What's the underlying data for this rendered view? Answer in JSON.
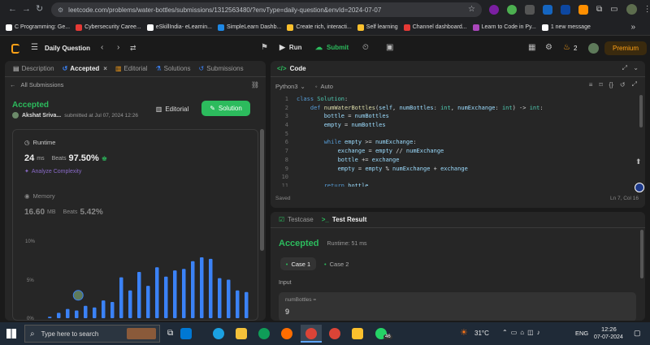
{
  "browser": {
    "url": "leetcode.com/problems/water-bottles/submissions/1312563480/?envType=daily-question&envId=2024-07-07",
    "bookmarks": [
      {
        "label": "C Programming: Ge...",
        "color": "#ffffff"
      },
      {
        "label": "Cybersecurity Caree...",
        "color": "#e53935"
      },
      {
        "label": "eSkillIndia- eLearnin...",
        "color": "#ffffff"
      },
      {
        "label": "SimpleLearn Dashb...",
        "color": "#1e88e5"
      },
      {
        "label": "Create rich, interacti...",
        "color": "#fbc02d"
      },
      {
        "label": "Self learning",
        "color": "#fbc02d"
      },
      {
        "label": "Channel dashboard...",
        "color": "#e53935"
      },
      {
        "label": "Learn to Code in Py...",
        "color": "#ab47bc"
      },
      {
        "label": "1 new message",
        "color": "#ffffff"
      }
    ]
  },
  "nav": {
    "title": "Daily Question",
    "run_label": "Run",
    "submit_label": "Submit",
    "streak": "2",
    "premium_label": "Premium"
  },
  "left": {
    "tabs": [
      "Description",
      "Accepted",
      "Editorial",
      "Solutions",
      "Submissions"
    ],
    "back_label": "All Submissions",
    "status": "Accepted",
    "author": "Akshat Sriva...",
    "submitted": "submitted at Jul 07, 2024 12:26",
    "editorial_btn": "Editorial",
    "solution_btn": "Solution",
    "runtime_label": "Runtime",
    "runtime_value": "24",
    "runtime_unit": "ms",
    "beats_label": "Beats",
    "runtime_beats": "97.50%",
    "analyze_label": "Analyze Complexity",
    "memory_label": "Memory",
    "memory_value": "16.60",
    "memory_unit": "MB",
    "memory_beats": "5.42%"
  },
  "chart_data": {
    "type": "bar",
    "ylim": [
      0,
      10
    ],
    "yticks": [
      "10%",
      "5%",
      "0%"
    ],
    "values": [
      0.2,
      0.7,
      1.2,
      1.0,
      1.6,
      1.4,
      2.3,
      2.1,
      5.3,
      3.6,
      6.0,
      4.2,
      6.6,
      5.4,
      6.2,
      6.4,
      7.4,
      7.9,
      7.7,
      5.2,
      5.0,
      3.6,
      3.4
    ],
    "highlight_index": 4
  },
  "code": {
    "header": "Code",
    "language": "Python3",
    "mode": "Auto",
    "lines": [
      {
        "n": "1",
        "html": "<span class='kw'>class</span> <span class='ty'>Solution</span>:"
      },
      {
        "n": "2",
        "html": "    <span class='kw'>def</span> <span class='fn'>numWaterBottles</span>(<span class='var'>self</span>, <span class='var'>numBottles</span>: <span class='ty'>int</span>, <span class='var'>numExchange</span>: <span class='ty'>int</span>) -> <span class='ty'>int</span>:"
      },
      {
        "n": "3",
        "html": "        <span class='var'>bottle</span> = <span class='var'>numBottles</span>"
      },
      {
        "n": "4",
        "html": "        <span class='var'>empty</span> = <span class='var'>numBottles</span>"
      },
      {
        "n": "5",
        "html": ""
      },
      {
        "n": "6",
        "html": "        <span class='kw'>while</span> <span class='var'>empty</span> >= <span class='var'>numExchange</span>:"
      },
      {
        "n": "7",
        "html": "            <span class='var'>exchange</span> = <span class='var'>empty</span> // <span class='var'>numExchange</span>"
      },
      {
        "n": "8",
        "html": "            <span class='var'>bottle</span> += <span class='var'>exchange</span>"
      },
      {
        "n": "9",
        "html": "            <span class='var'>empty</span> = <span class='var'>empty</span> % <span class='var'>numExchange</span> + <span class='var'>exchange</span>"
      },
      {
        "n": "10",
        "html": ""
      },
      {
        "n": "11",
        "html": "        <span class='kw'>return</span> <span class='var'>bottle</span>"
      }
    ],
    "saved_label": "Saved",
    "cursor_pos": "Ln 7, Col 16"
  },
  "result": {
    "tab_testcase": "Testcase",
    "tab_result": "Test Result",
    "status": "Accepted",
    "runtime": "Runtime: 51 ms",
    "case1": "Case 1",
    "case2": "Case 2",
    "input_label": "Input",
    "param_name": "numBottles =",
    "param_value": "9"
  },
  "taskbar": {
    "search_placeholder": "Type here to search",
    "weather": "31°C",
    "lang": "ENG",
    "time": "12:26",
    "date": "07-07-2024",
    "notif": "46"
  }
}
